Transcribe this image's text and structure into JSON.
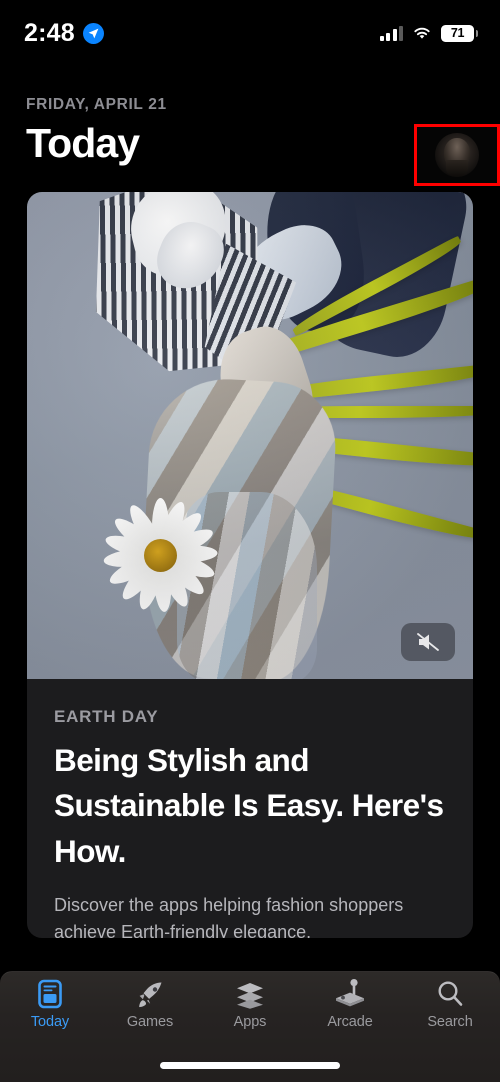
{
  "status_bar": {
    "time": "2:48",
    "location_icon": "location-arrow-icon",
    "signal_icon": "cellular-signal-icon",
    "wifi_icon": "wifi-icon",
    "battery_percent": "71"
  },
  "header": {
    "date": "FRIDAY, APRIL 21",
    "title": "Today",
    "avatar_name": "profile-avatar"
  },
  "hero_card": {
    "mute_icon": "mute-speaker-icon",
    "eyebrow": "EARTH DAY",
    "headline": "Being Stylish and Sustainable Is Easy. Here's How.",
    "subcopy": "Discover the apps helping fashion shoppers achieve Earth-friendly elegance."
  },
  "tab_bar": {
    "items": [
      {
        "label": "Today",
        "icon": "today-card-icon",
        "active": true
      },
      {
        "label": "Games",
        "icon": "rocket-icon",
        "active": false
      },
      {
        "label": "Apps",
        "icon": "stacked-layers-icon",
        "active": false
      },
      {
        "label": "Arcade",
        "icon": "joystick-icon",
        "active": false
      },
      {
        "label": "Search",
        "icon": "magnifier-icon",
        "active": false
      }
    ]
  },
  "colors": {
    "background": "#000000",
    "accent": "#3b9bf5",
    "card": "#1c1c1e",
    "annotation_box": "#ff0000",
    "inactive_tab": "#9a9a9e"
  }
}
